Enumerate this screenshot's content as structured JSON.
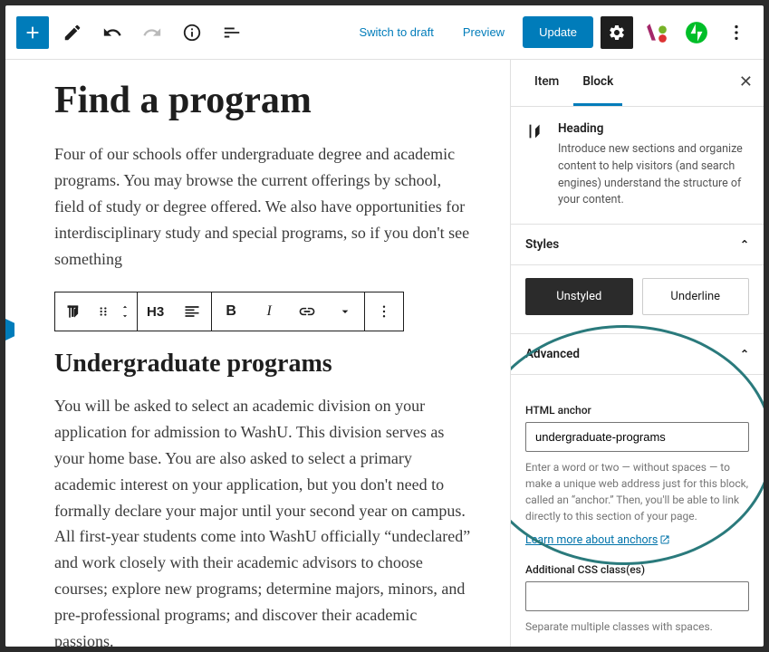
{
  "topbar": {
    "switch_draft": "Switch to draft",
    "preview": "Preview",
    "update": "Update"
  },
  "editor": {
    "title": "Find a program",
    "para1": "Four of our schools offer undergraduate degree and academic programs. You may browse the current offerings by school, field of study or degree offered. We also have opportunities for interdisciplinary study and special programs, so if you don't see something",
    "heading_level": "H3",
    "heading3": "Undergraduate programs",
    "para2": "You will be asked to select an academic division on your application for admission to WashU. This division serves as your home base. You are also asked to select a primary academic interest on your application, but you don't need to formally declare your major until your second year on campus. All first-year students come into WashU officially “undeclared” and work closely with their academic advisors to choose courses; explore new programs; determine majors, minors, and pre-professional programs; and discover their academic passions."
  },
  "sidebar": {
    "tab_item": "Item",
    "tab_block": "Block",
    "block_name": "Heading",
    "block_desc": "Introduce new sections and organize content to help visitors (and search engines) understand the structure of your content.",
    "styles_header": "Styles",
    "style_unstyled": "Unstyled",
    "style_underline": "Underline",
    "advanced_header": "Advanced",
    "anchor_label": "HTML anchor",
    "anchor_value": "undergraduate-programs",
    "anchor_help": "Enter a word or two — without spaces — to make a unique web address just for this block, called an “anchor.” Then, you'll be able to link directly to this section of your page.",
    "anchor_link": "Learn more about anchors",
    "css_label": "Additional CSS class(es)",
    "css_value": "",
    "css_help": "Separate multiple classes with spaces."
  }
}
